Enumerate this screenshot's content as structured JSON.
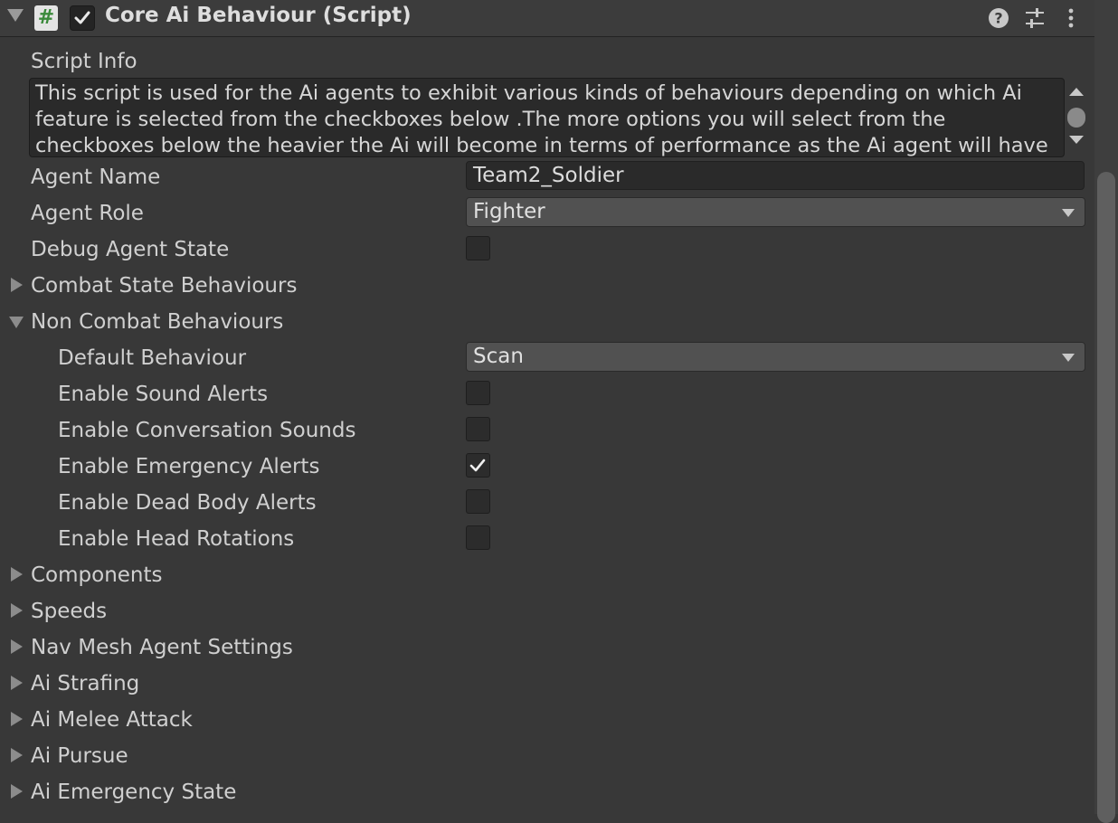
{
  "header": {
    "title": "Core Ai Behaviour (Script)",
    "script_icon_glyph": "#",
    "enabled": true,
    "icons": [
      "help-icon",
      "preset-sliders-icon",
      "kebab-menu-icon"
    ]
  },
  "script_info": {
    "label": "Script Info",
    "text": "This script is used for the Ai agents to exhibit various kinds of behaviours depending on which Ai feature is selected from the checkboxes below .The more options you will select from the checkboxes below the heavier the Ai will become in terms of performance as the Ai agent will have more abilities"
  },
  "fields": {
    "agent_name": {
      "label": "Agent Name",
      "value": "Team2_Soldier"
    },
    "agent_role": {
      "label": "Agent Role",
      "value": "Fighter"
    },
    "debug_agent_state": {
      "label": "Debug Agent State",
      "checked": false
    }
  },
  "sections": {
    "combat": {
      "label": "Combat State Behaviours",
      "expanded": false
    },
    "non_combat": {
      "label": "Non Combat Behaviours",
      "expanded": true,
      "default_behaviour": {
        "label": "Default Behaviour",
        "value": "Scan"
      },
      "checkboxes": [
        {
          "label": "Enable Sound Alerts",
          "checked": false
        },
        {
          "label": "Enable Conversation Sounds",
          "checked": false
        },
        {
          "label": "Enable Emergency Alerts",
          "checked": true
        },
        {
          "label": "Enable Dead Body Alerts",
          "checked": false
        },
        {
          "label": "Enable Head Rotations",
          "checked": false
        }
      ]
    },
    "collapsed": [
      {
        "label": "Components"
      },
      {
        "label": "Speeds"
      },
      {
        "label": "Nav Mesh Agent Settings"
      },
      {
        "label": "Ai Strafing"
      },
      {
        "label": "Ai Melee Attack"
      },
      {
        "label": "Ai Pursue"
      },
      {
        "label": "Ai Emergency State"
      }
    ]
  },
  "colors": {
    "background": "#383838",
    "header": "#3c3c3c",
    "field": "#2a2a2a",
    "dropdown": "#515151",
    "text": "#d2d2d2"
  }
}
